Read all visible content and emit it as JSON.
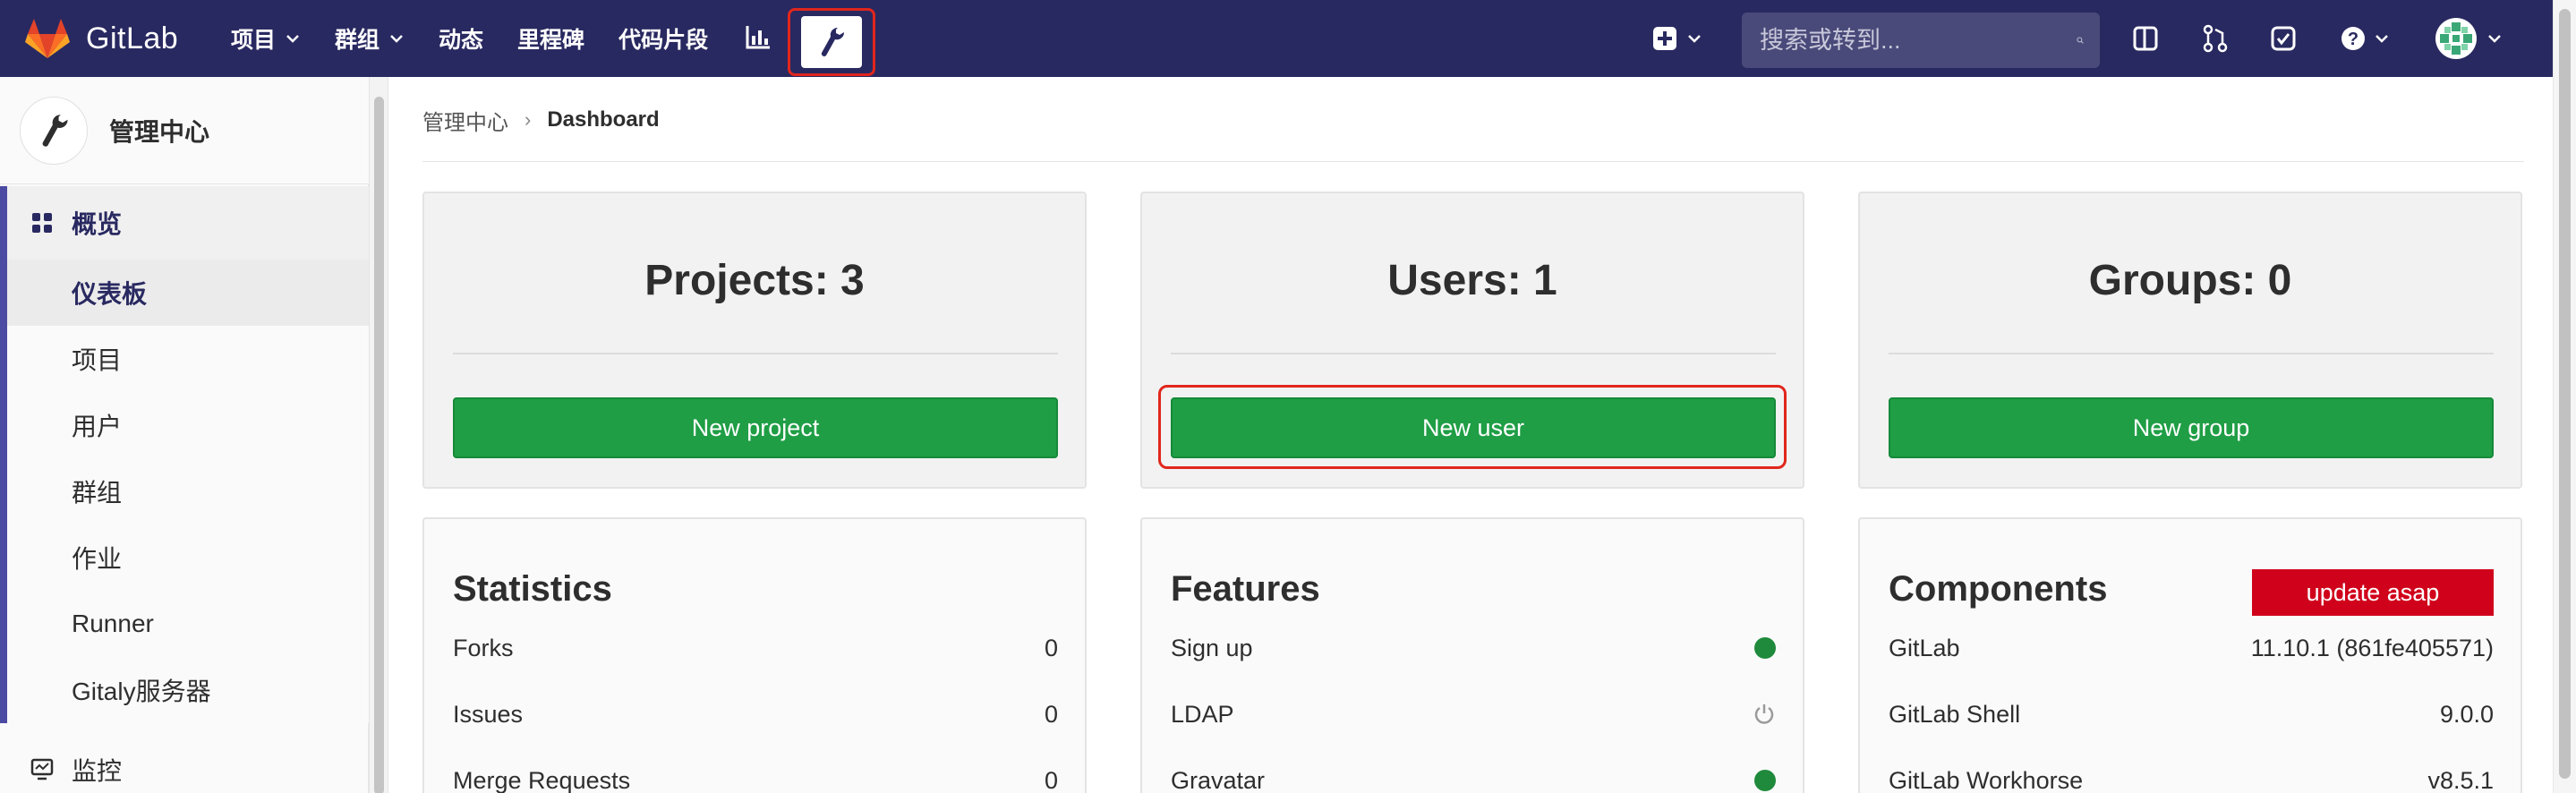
{
  "navbar": {
    "brand": "GitLab",
    "menu": [
      {
        "label": "项目",
        "has_caret": true
      },
      {
        "label": "群组",
        "has_caret": true
      },
      {
        "label": "动态",
        "has_caret": false
      },
      {
        "label": "里程碑",
        "has_caret": false
      },
      {
        "label": "代码片段",
        "has_caret": false
      }
    ],
    "search_placeholder": "搜索或转到...",
    "icons": [
      "chart-icon",
      "wrench-icon",
      "plus-square-icon",
      "search-icon",
      "sidebar-toggle-icon",
      "merge-request-icon",
      "todo-check-icon",
      "help-icon",
      "user-avatar"
    ]
  },
  "sidebar": {
    "title": "管理中心",
    "group_label": "概览",
    "items": [
      {
        "label": "仪表板",
        "active": true
      },
      {
        "label": "项目",
        "active": false
      },
      {
        "label": "用户",
        "active": false
      },
      {
        "label": "群组",
        "active": false
      },
      {
        "label": "作业",
        "active": false
      },
      {
        "label": "Runner",
        "active": false
      },
      {
        "label": "Gitaly服务器",
        "active": false
      }
    ],
    "next_group_label": "监控"
  },
  "breadcrumb": {
    "parent": "管理中心",
    "current": "Dashboard"
  },
  "stats": [
    {
      "title": "Projects: 3",
      "button": "New project"
    },
    {
      "title": "Users: 1",
      "button": "New user"
    },
    {
      "title": "Groups: 0",
      "button": "New group"
    }
  ],
  "statistics": {
    "title": "Statistics",
    "rows": [
      {
        "label": "Forks",
        "value": "0"
      },
      {
        "label": "Issues",
        "value": "0"
      },
      {
        "label": "Merge Requests",
        "value": "0"
      }
    ]
  },
  "features": {
    "title": "Features",
    "rows": [
      {
        "label": "Sign up",
        "status": "enabled"
      },
      {
        "label": "LDAP",
        "status": "disabled"
      },
      {
        "label": "Gravatar",
        "status": "enabled"
      }
    ]
  },
  "components": {
    "title": "Components",
    "badge": "update asap",
    "rows": [
      {
        "label": "GitLab",
        "value": "11.10.1 (861fe405571)"
      },
      {
        "label": "GitLab Shell",
        "value": "9.0.0"
      },
      {
        "label": "GitLab Workhorse",
        "value": "v8.5.1"
      }
    ]
  },
  "colors": {
    "navbar": "#292961",
    "green_button": "#1f9e45",
    "highlight_red": "#e1261c",
    "badge_red": "#d0021b",
    "status_green": "#1f8a3b"
  }
}
